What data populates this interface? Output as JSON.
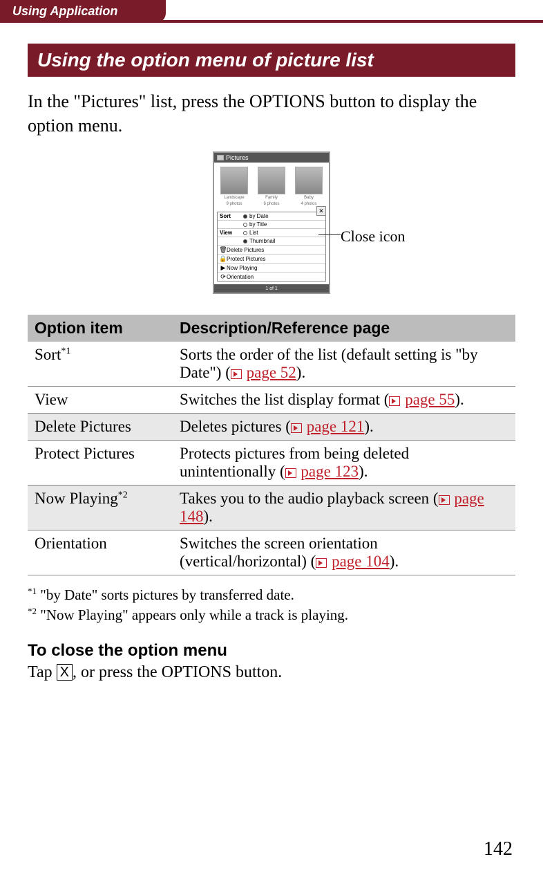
{
  "header": {
    "tab": "Using Application"
  },
  "section_title": "Using the option menu of picture list",
  "intro": "In the \"Pictures\" list, press the OPTIONS button to display the option menu.",
  "callout": "Close icon",
  "device": {
    "title": "Pictures",
    "thumbs": [
      {
        "name": "Landscape",
        "sub": "9 photos"
      },
      {
        "name": "Family",
        "sub": "6 photos"
      },
      {
        "name": "Baby",
        "sub": "4 photos"
      }
    ],
    "menu": {
      "sort_label": "Sort",
      "sort_by_date": "by Date",
      "sort_by_title": "by Title",
      "view_label": "View",
      "view_list": "List",
      "view_thumb": "Thumbnail",
      "delete": "Delete Pictures",
      "protect": "Protect Pictures",
      "now_playing": "Now Playing",
      "orientation": "Orientation"
    },
    "footer": "1 of 1"
  },
  "table": {
    "head_option": "Option item",
    "head_desc": "Description/Reference page",
    "rows": [
      {
        "option": "Sort",
        "sup": "*1",
        "desc_pre": "Sorts the order of the list (default setting is \"by Date\") (",
        "page": "page 52",
        "desc_post": ")."
      },
      {
        "option": "View",
        "sup": "",
        "desc_pre": "Switches the list display format (",
        "page": "page 55",
        "desc_post": ")."
      },
      {
        "option": "Delete Pictures",
        "sup": "",
        "desc_pre": "Deletes pictures (",
        "page": "page 121",
        "desc_post": ")."
      },
      {
        "option": "Protect Pictures",
        "sup": "",
        "desc_pre": "Protects pictures from being deleted unintentionally (",
        "page": "page 123",
        "desc_post": ")."
      },
      {
        "option": "Now Playing",
        "sup": "*2",
        "desc_pre": "Takes you to the audio playback screen (",
        "page": "page 148",
        "desc_post": ")."
      },
      {
        "option": "Orientation",
        "sup": "",
        "desc_pre": "Switches the screen orientation (vertical/horizontal) (",
        "page": "page 104",
        "desc_post": ")."
      }
    ]
  },
  "footnotes": {
    "f1_sup": "*1",
    "f1": " \"by Date\" sorts pictures by transferred date.",
    "f2_sup": "*2",
    "f2": " \"Now Playing\" appears only while a track is playing."
  },
  "close_section": {
    "title": "To close the option menu",
    "pre": "Tap ",
    "x": "X",
    "post": ", or press the OPTIONS button."
  },
  "page_number": "142"
}
